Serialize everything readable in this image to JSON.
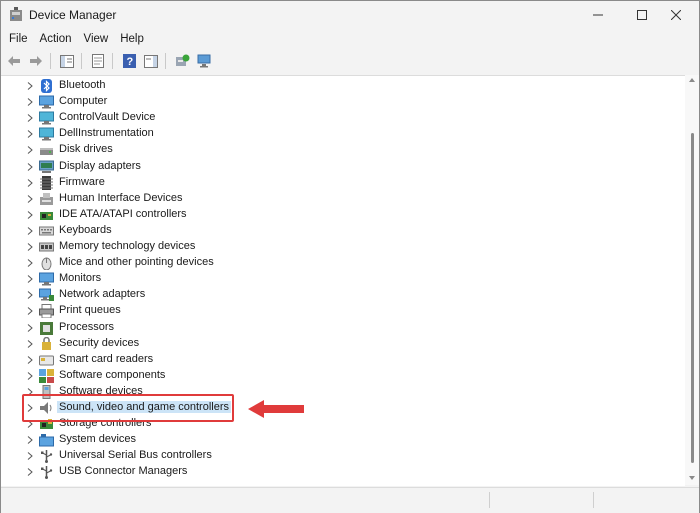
{
  "window": {
    "title": "Device Manager"
  },
  "menu": [
    "File",
    "Action",
    "View",
    "Help"
  ],
  "toolbar": {
    "buttons": [
      "back-icon",
      "forward-icon",
      "show-hide-console-tree-icon",
      "properties-icon",
      "help-icon",
      "action-pane-icon",
      "update-driver-icon",
      "scan-hardware-icon"
    ]
  },
  "tree": {
    "items": [
      {
        "label": "Bluetooth",
        "icon": "bluetooth-icon"
      },
      {
        "label": "Computer",
        "icon": "computer-icon"
      },
      {
        "label": "ControlVault Device",
        "icon": "controlvault-icon"
      },
      {
        "label": "DellInstrumentation",
        "icon": "dell-instrumentation-icon"
      },
      {
        "label": "Disk drives",
        "icon": "disk-drive-icon"
      },
      {
        "label": "Display adapters",
        "icon": "display-adapter-icon"
      },
      {
        "label": "Firmware",
        "icon": "firmware-icon"
      },
      {
        "label": "Human Interface Devices",
        "icon": "hid-icon"
      },
      {
        "label": "IDE ATA/ATAPI controllers",
        "icon": "ide-controller-icon"
      },
      {
        "label": "Keyboards",
        "icon": "keyboard-icon"
      },
      {
        "label": "Memory technology devices",
        "icon": "memory-device-icon"
      },
      {
        "label": "Mice and other pointing devices",
        "icon": "mouse-icon"
      },
      {
        "label": "Monitors",
        "icon": "monitor-icon"
      },
      {
        "label": "Network adapters",
        "icon": "network-adapter-icon"
      },
      {
        "label": "Print queues",
        "icon": "printer-icon"
      },
      {
        "label": "Processors",
        "icon": "processor-icon"
      },
      {
        "label": "Security devices",
        "icon": "security-device-icon"
      },
      {
        "label": "Smart card readers",
        "icon": "smart-card-icon"
      },
      {
        "label": "Software components",
        "icon": "software-component-icon"
      },
      {
        "label": "Software devices",
        "icon": "software-device-icon"
      },
      {
        "label": "Sound, video and game controllers",
        "icon": "speaker-icon",
        "selected": true
      },
      {
        "label": "Storage controllers",
        "icon": "storage-controller-icon"
      },
      {
        "label": "System devices",
        "icon": "system-device-icon"
      },
      {
        "label": "Universal Serial Bus controllers",
        "icon": "usb-icon"
      },
      {
        "label": "USB Connector Managers",
        "icon": "usb-connector-icon"
      }
    ]
  },
  "annotation": {
    "color": "#e03b3b"
  }
}
